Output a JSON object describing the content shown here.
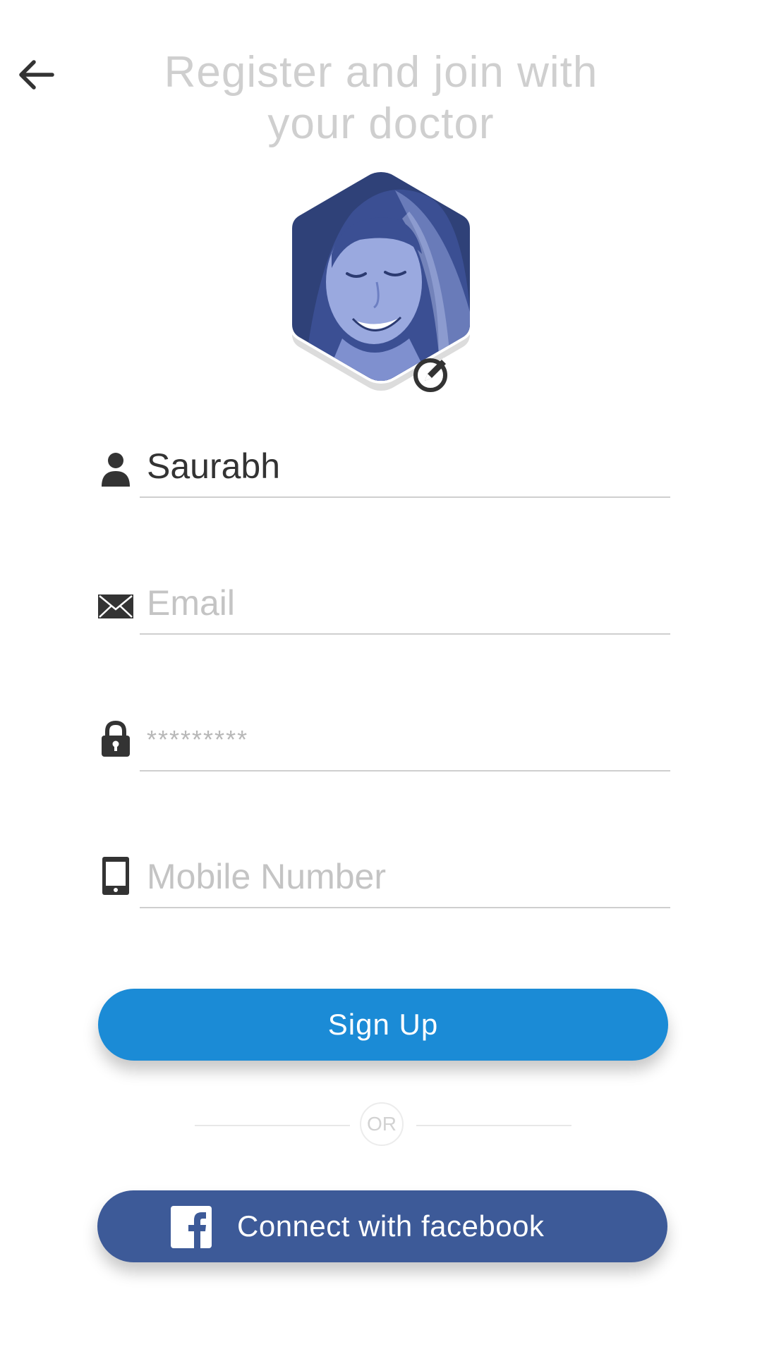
{
  "header": {
    "back_icon": "arrow-left-icon",
    "title_line1": "Register and join with",
    "title_line2": "your doctor"
  },
  "avatar": {
    "edit_icon": "pencil-circle-icon",
    "tint_color": "#3b4f93"
  },
  "form": {
    "name": {
      "icon": "person-icon",
      "value": "Saurabh",
      "placeholder": ""
    },
    "email": {
      "icon": "envelope-icon",
      "value": "",
      "placeholder": "Email"
    },
    "password": {
      "icon": "lock-icon",
      "value": "",
      "placeholder": "*********"
    },
    "mobile": {
      "icon": "mobile-phone-icon",
      "value": "",
      "placeholder": "Mobile Number"
    }
  },
  "actions": {
    "signup_label": "Sign Up",
    "or_label": "OR",
    "facebook_label": "Connect with facebook",
    "facebook_icon": "facebook-icon"
  },
  "colors": {
    "signup_button": "#1b8bd6",
    "facebook_button": "#3d5a98",
    "title_text": "#cfcfcf",
    "icon_dark": "#333333"
  }
}
